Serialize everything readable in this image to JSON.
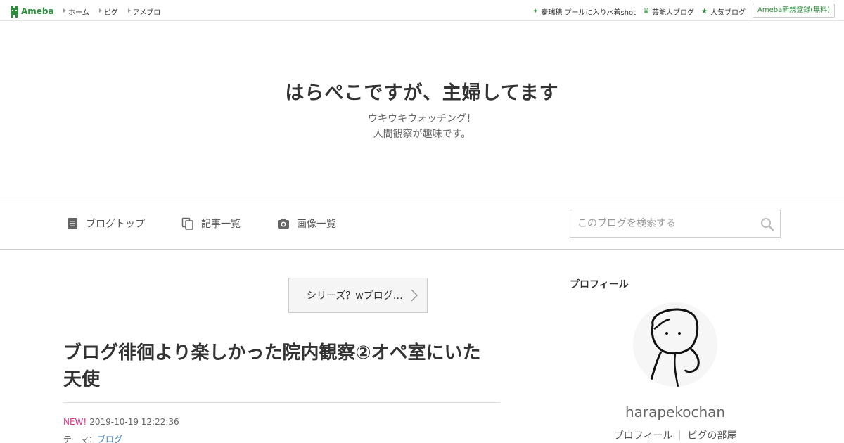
{
  "topbar": {
    "logo_text": "Ameba",
    "links": [
      "ホーム",
      "ピグ",
      "アメブロ"
    ],
    "right_links": [
      {
        "icon": "sparkle-icon",
        "label": "秦瑞穂 プールに入り水着shot"
      },
      {
        "icon": "crown-icon",
        "label": "芸能人ブログ"
      },
      {
        "icon": "star-icon",
        "label": "人気ブログ"
      }
    ],
    "signup_label": "Ameba新規登録(無料)"
  },
  "header": {
    "title": "はらぺこですが、主婦してます",
    "description_line1": "ウキウキウォッチング！",
    "description_line2": "人間観察が趣味です。"
  },
  "nav": {
    "items": [
      {
        "icon": "document-icon",
        "label": "ブログトップ"
      },
      {
        "icon": "copy-icon",
        "label": "記事一覧"
      },
      {
        "icon": "camera-icon",
        "label": "画像一覧"
      }
    ],
    "search_placeholder": "このブログを検索する"
  },
  "main": {
    "theme_button": "シリーズ？wブログ…",
    "article_title_line1": "ブログ徘徊より楽しかった院内観察②オペ室にいた",
    "article_title_line2": "天使",
    "new_badge": "NEW!",
    "date": "2019-10-19 12:22:36",
    "theme_label": "テーマ：",
    "theme_value": "ブログ"
  },
  "sidebar": {
    "heading": "プロフィール",
    "username": "harapekochan",
    "links": [
      "プロフィール",
      "ピグの部屋"
    ]
  },
  "colors": {
    "brand_green": "#2d8c3c",
    "new_pink": "#e0308b",
    "link_blue": "#3474b8"
  }
}
